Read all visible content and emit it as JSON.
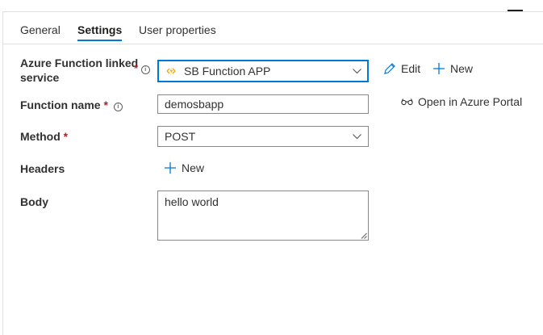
{
  "tabs": [
    {
      "label": "General"
    },
    {
      "label": "Settings"
    },
    {
      "label": "User properties"
    }
  ],
  "linked_service": {
    "label_line1": "Azure Function linked",
    "label_line2": "service",
    "required_mark": "*",
    "value": "SB Function APP",
    "edit_label": "Edit",
    "new_label": "New"
  },
  "function_name": {
    "label": "Function name",
    "required_mark": "*",
    "value": "demosbapp",
    "open_portal_label": "Open in Azure Portal"
  },
  "method": {
    "label": "Method",
    "required_mark": "*",
    "value": "POST"
  },
  "headers": {
    "label": "Headers",
    "new_label": "New"
  },
  "body": {
    "label": "Body",
    "value": "hello world"
  },
  "colors": {
    "accent": "#0078d4",
    "required": "#a4262c",
    "function_icon": "#f2a900"
  },
  "icons": [
    "info-icon",
    "azure-function-icon",
    "chevron-down-icon",
    "pencil-icon",
    "plus-icon",
    "glasses-icon",
    "resize-grip-icon"
  ]
}
